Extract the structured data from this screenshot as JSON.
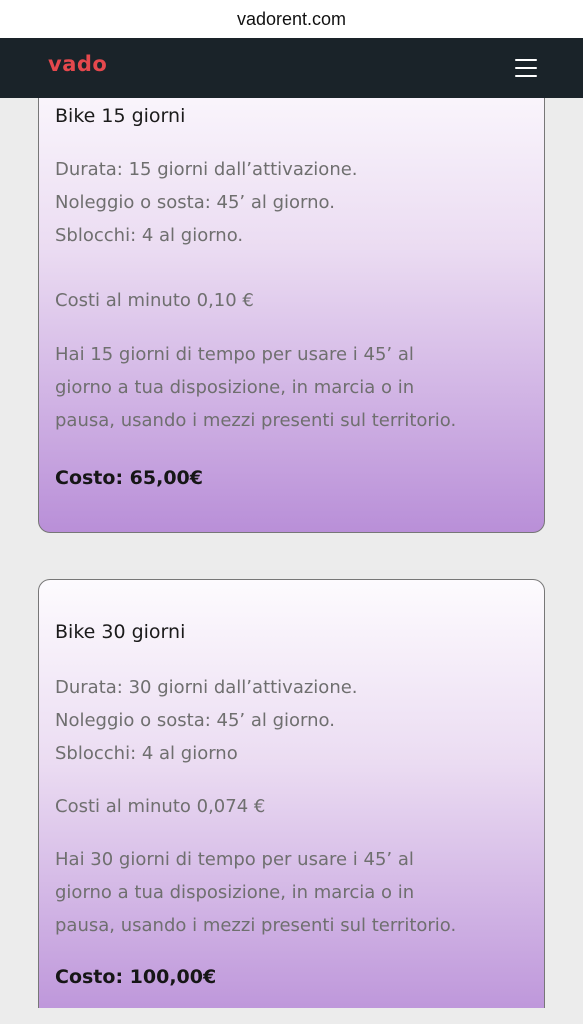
{
  "browser": {
    "url": "vadorent.com"
  },
  "header": {
    "logo": "vado",
    "menu_icon": "hamburger-menu-icon"
  },
  "colors": {
    "navbar": "#1a2329",
    "logo": "#e5484d",
    "card_gradient_top": "#fdfbfe",
    "card_gradient_bottom": "#b98fd8"
  },
  "plans": [
    {
      "title": "Bike 15 giorni",
      "details": [
        "Durata: 15 giorni dall’attivazione.",
        "Noleggio o sosta: 45’ al giorno.",
        "Sblocchi: 4 al giorno."
      ],
      "cost_per_minute": "Costi al minuto 0,10 €",
      "description": [
        "Hai 15 giorni di  tempo per usare i 45’ al",
        "giorno a tua disposizione, in marcia o in",
        "pausa, usando i mezzi presenti sul territorio."
      ],
      "price": "Costo: 65,00€"
    },
    {
      "title": "Bike 30 giorni",
      "details": [
        "Durata: 30 giorni dall’attivazione.",
        "Noleggio o sosta: 45’ al giorno.",
        "Sblocchi: 4 al giorno"
      ],
      "cost_per_minute": "Costi al minuto 0,074 €",
      "description": [
        "Hai 30 giorni di  tempo per usare i 45’ al",
        "giorno a tua disposizione, in marcia o in",
        "pausa, usando i mezzi presenti sul territorio."
      ],
      "price": "Costo: 100,00€"
    }
  ]
}
